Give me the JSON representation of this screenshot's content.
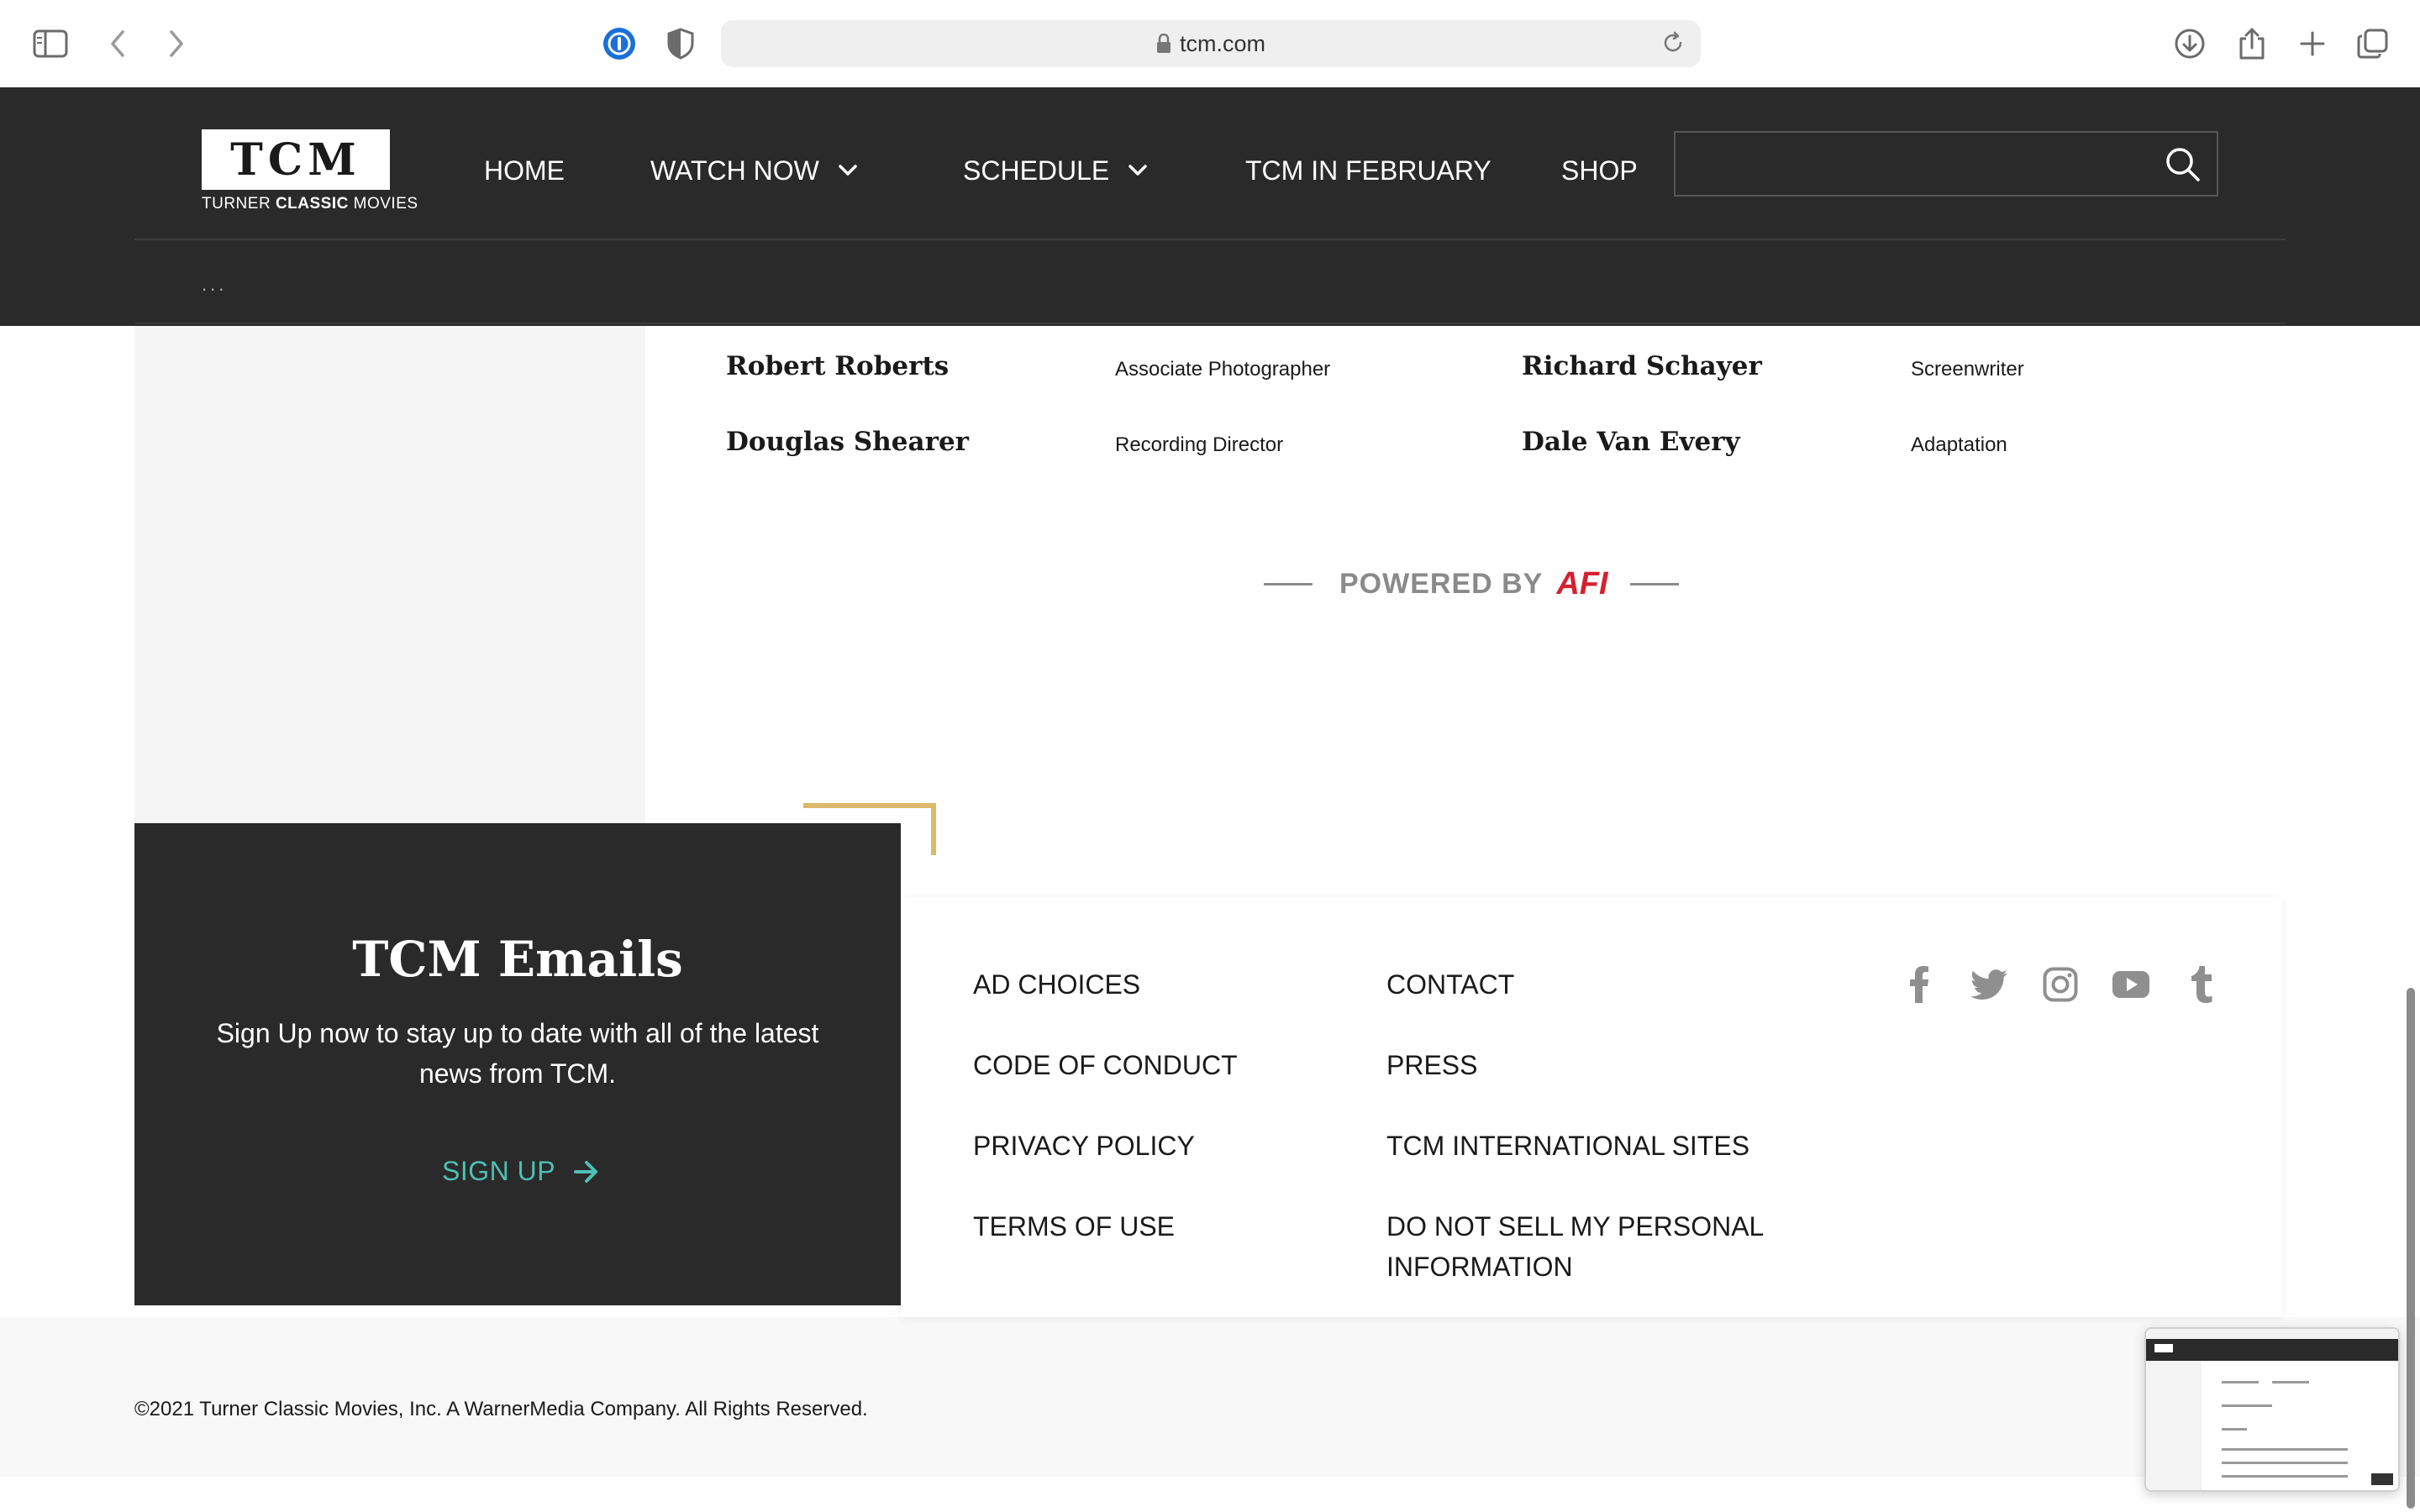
{
  "browser": {
    "url": "tcm.com"
  },
  "header": {
    "logo_text": "TCM",
    "logo_sub_prefix": "TURNER ",
    "logo_sub_bold": "CLASSIC",
    "logo_sub_suffix": " MOVIES",
    "nav": {
      "home": "HOME",
      "watch_now": "WATCH NOW",
      "schedule": "SCHEDULE",
      "tcm_in_february": "TCM IN FEBRUARY",
      "shop": "SHOP"
    },
    "search": {
      "value": "",
      "placeholder": ""
    },
    "breadcrumb": "..."
  },
  "crew": {
    "entries": [
      {
        "name": "Robert Roberts",
        "role": "Associate Photographer"
      },
      {
        "name": "Richard Schayer",
        "role": "Screenwriter"
      },
      {
        "name": "Douglas Shearer",
        "role": "Recording Director"
      },
      {
        "name": "Dale Van Every",
        "role": "Adaptation"
      }
    ]
  },
  "powered": {
    "label": "POWERED BY",
    "brand": "AFI"
  },
  "emails": {
    "title": "TCM Emails",
    "description": "Sign Up now to stay up to date with all of the latest news from TCM.",
    "signup_label": "SIGN UP"
  },
  "footer": {
    "links": {
      "ad_choices": "AD CHOICES",
      "contact": "CONTACT",
      "code_of_conduct": "CODE OF CONDUCT",
      "press": "PRESS",
      "privacy_policy": "PRIVACY POLICY",
      "international_sites": "TCM INTERNATIONAL SITES",
      "terms_of_use": "TERMS OF USE",
      "do_not_sell": "DO NOT SELL MY PERSONAL INFORMATION"
    },
    "social": [
      "facebook-icon",
      "twitter-icon",
      "instagram-icon",
      "youtube-icon",
      "tumblr-icon"
    ],
    "copyright": "©2021 Turner Classic Movies, Inc. A WarnerMedia Company. All Rights Reserved."
  },
  "colors": {
    "header_bg": "#2a2a2a",
    "accent_teal": "#4ec0b4",
    "accent_gold": "#dcb96a",
    "afi_red": "#d6202e"
  }
}
